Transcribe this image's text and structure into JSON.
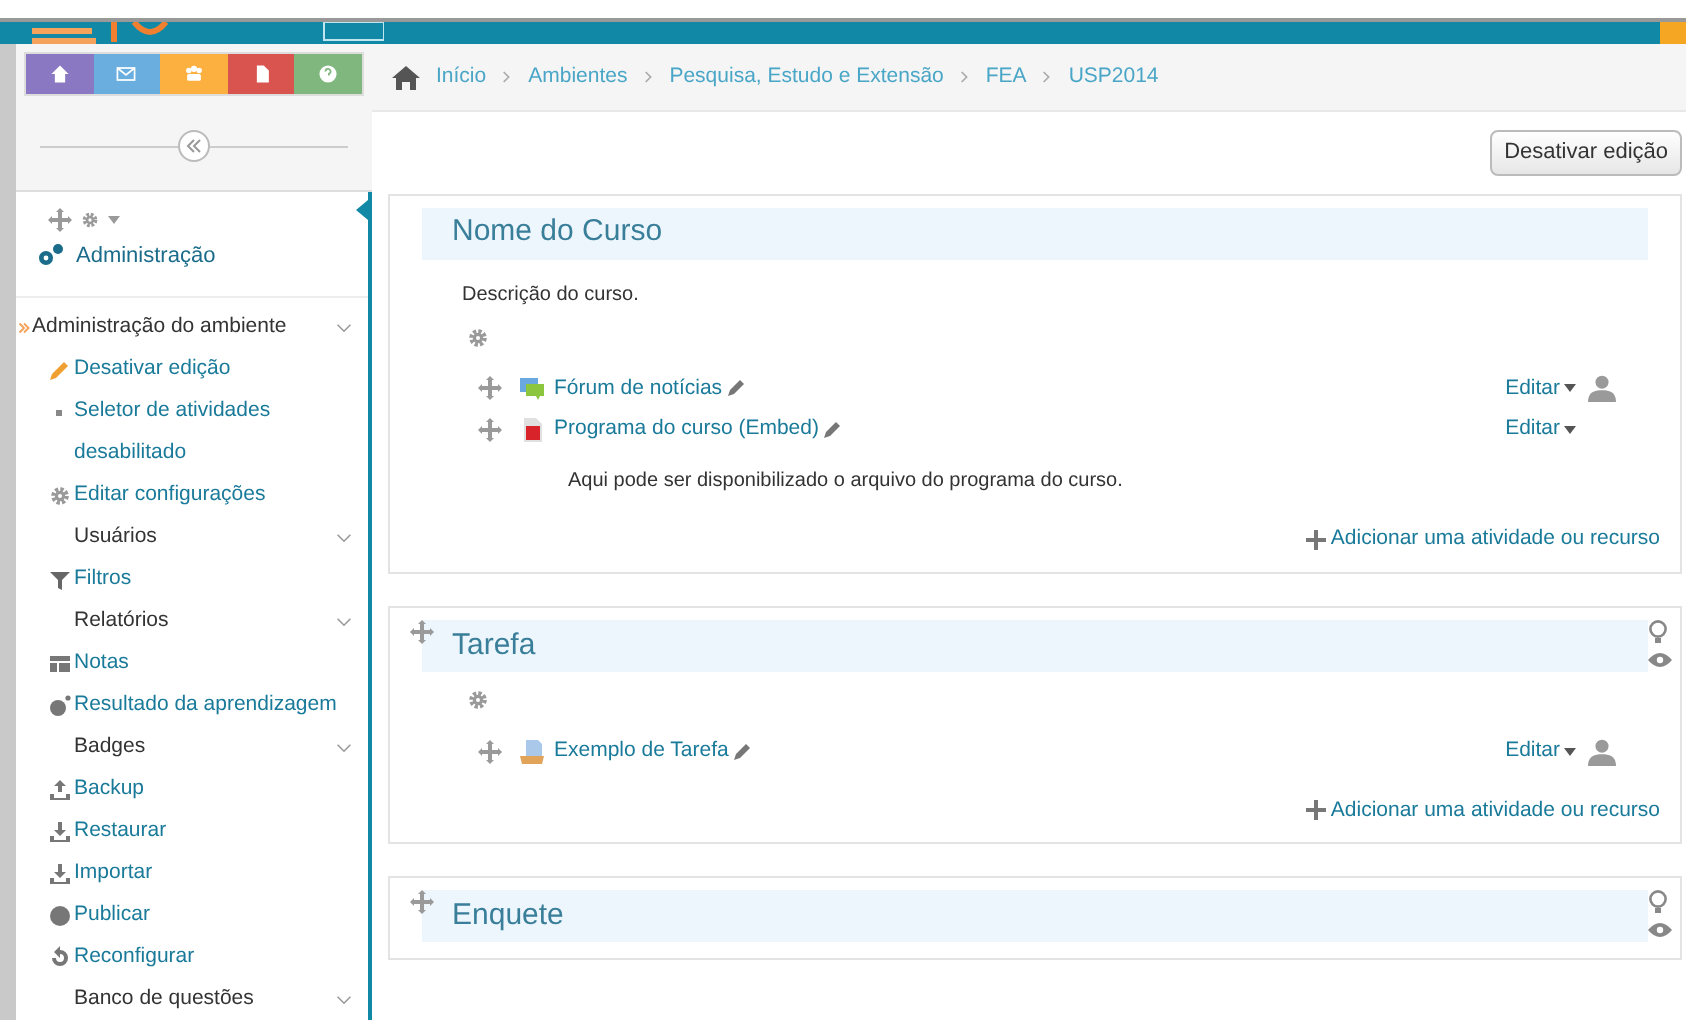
{
  "nav_buttons": [
    {
      "color": "#8b78c2"
    },
    {
      "color": "#6aaee0"
    },
    {
      "color": "#fbb040"
    },
    {
      "color": "#d9534f"
    },
    {
      "color": "#7fb77e"
    }
  ],
  "breadcrumb": [
    "Início",
    "Ambientes",
    "Pesquisa, Estudo e Extensão",
    "FEA",
    "USP2014"
  ],
  "edit_button": "Desativar edição",
  "admin_block": {
    "title": "Administração",
    "root": "Administração do ambiente",
    "items": [
      {
        "label": "Desativar edição",
        "kind": "link"
      },
      {
        "label": "Seletor de atividades desabilitado",
        "kind": "link"
      },
      {
        "label": "Editar configurações",
        "kind": "link"
      },
      {
        "label": "Usuários",
        "kind": "folder"
      },
      {
        "label": "Filtros",
        "kind": "link"
      },
      {
        "label": "Relatórios",
        "kind": "folder"
      },
      {
        "label": "Notas",
        "kind": "link"
      },
      {
        "label": "Resultado da aprendizagem",
        "kind": "link"
      },
      {
        "label": "Badges",
        "kind": "folder"
      },
      {
        "label": "Backup",
        "kind": "link"
      },
      {
        "label": "Restaurar",
        "kind": "link"
      },
      {
        "label": "Importar",
        "kind": "link"
      },
      {
        "label": "Publicar",
        "kind": "link"
      },
      {
        "label": "Reconfigurar",
        "kind": "link"
      },
      {
        "label": "Banco de questões",
        "kind": "folder"
      }
    ]
  },
  "sections": [
    {
      "title": "Nome do Curso",
      "movable": false,
      "summary": "Descrição do curso.",
      "activities": [
        {
          "name": "Fórum de notícias",
          "kind": "forum",
          "edit": "Editar",
          "group_icon": true
        },
        {
          "name": "Programa do curso (Embed)",
          "kind": "pdf",
          "edit": "Editar",
          "group_icon": false,
          "description": "Aqui pode ser disponibilizado o arquivo do programa do curso."
        }
      ],
      "add": "Adicionar uma atividade ou recurso"
    },
    {
      "title": "Tarefa",
      "movable": true,
      "activities": [
        {
          "name": "Exemplo de Tarefa",
          "kind": "assign",
          "edit": "Editar",
          "group_icon": true
        }
      ],
      "add": "Adicionar uma atividade ou recurso"
    },
    {
      "title": "Enquete",
      "movable": true
    }
  ]
}
